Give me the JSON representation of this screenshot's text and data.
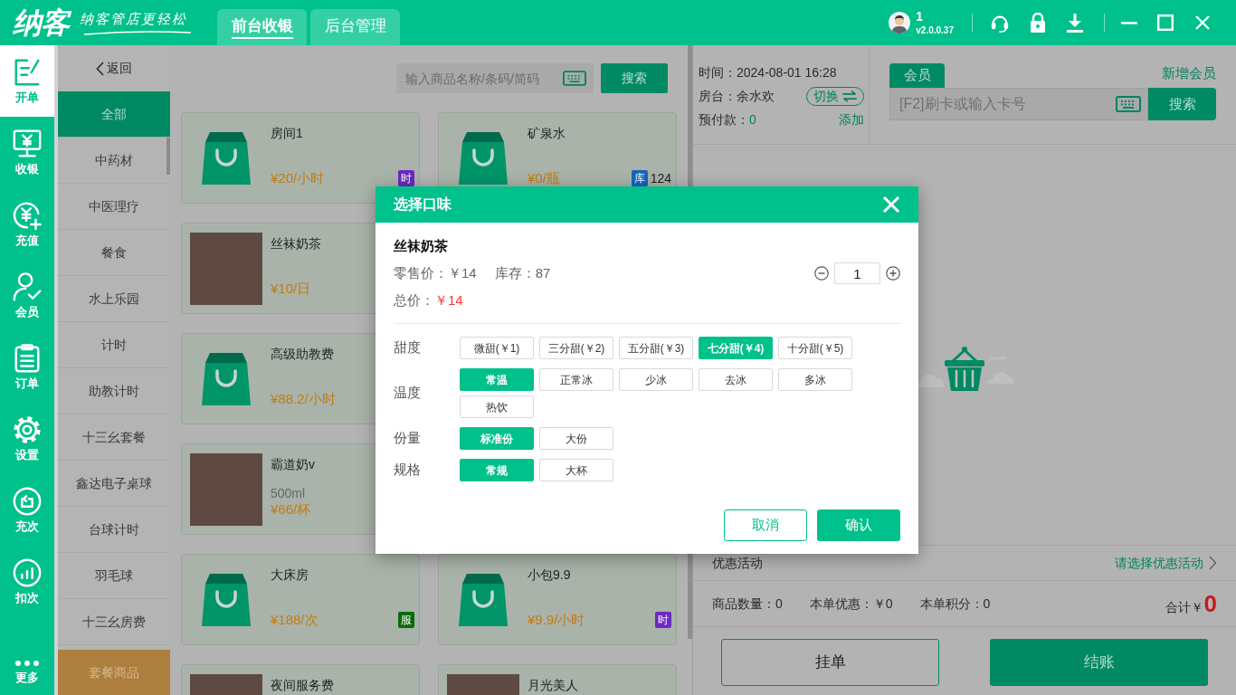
{
  "app_bar": {
    "logo": "纳客",
    "slogan": "纳客管店更轻松",
    "tabs": [
      {
        "label": "前台收银",
        "selected": true
      },
      {
        "label": "后台管理",
        "selected": false
      }
    ],
    "user": "1",
    "version": "v2.0.0.37"
  },
  "nav": [
    {
      "label": "开单",
      "selected": true
    },
    {
      "label": "收银",
      "selected": false
    },
    {
      "label": "充值",
      "selected": false
    },
    {
      "label": "会员",
      "selected": false
    },
    {
      "label": "订单",
      "selected": false
    },
    {
      "label": "设置",
      "selected": false
    },
    {
      "label": "充次",
      "selected": false
    },
    {
      "label": "扣次",
      "selected": false
    }
  ],
  "nav_more": "更多",
  "categories": {
    "back": "返回",
    "items": [
      {
        "label": "全部",
        "selected": true
      },
      {
        "label": "中药材",
        "selected": false
      },
      {
        "label": "中医理疗",
        "selected": false
      },
      {
        "label": "餐食",
        "selected": false
      },
      {
        "label": "水上乐园",
        "selected": false
      },
      {
        "label": "计时",
        "selected": false
      },
      {
        "label": "助教计时",
        "selected": false
      },
      {
        "label": "十三幺套餐",
        "selected": false
      },
      {
        "label": "鑫达电子桌球",
        "selected": false
      },
      {
        "label": "台球计时",
        "selected": false
      },
      {
        "label": "羽毛球",
        "selected": false
      },
      {
        "label": "十三幺房费",
        "selected": false
      }
    ],
    "package": "套餐商品"
  },
  "product_search": {
    "placeholder": "输入商品名称/条码/简码",
    "button": "搜索"
  },
  "product_rows": [
    [
      {
        "kind": "bag",
        "name": "房间1",
        "price": "¥20/小时",
        "badge": {
          "text": "时",
          "color": "#6a2bbd"
        }
      },
      {
        "kind": "bag",
        "name": "矿泉水",
        "price": "¥0/瓶",
        "badge": {
          "text": "库",
          "color": "#1565c0"
        },
        "stock": "124"
      }
    ],
    [
      {
        "kind": "photo",
        "name": "丝袜奶茶",
        "price": "¥10/日"
      }
    ],
    [
      {
        "kind": "bag",
        "name": "高级助教费",
        "price": "¥88.2/小时"
      }
    ],
    [
      {
        "kind": "photo",
        "name": "霸道奶v",
        "spec": "500ml",
        "price": "¥66/杯"
      }
    ],
    [
      {
        "kind": "bag",
        "name": "大床房",
        "price": "¥188/次",
        "badge": {
          "text": "服",
          "color": "#0b6b0b"
        }
      },
      {
        "kind": "bag",
        "name": "小包9.9",
        "price": "¥9.9/小时",
        "badge": {
          "text": "时",
          "color": "#6a2bbd"
        }
      }
    ],
    [
      {
        "kind": "photo",
        "name": "夜间服务费"
      },
      {
        "kind": "photo",
        "name": "月光美人"
      }
    ]
  ],
  "order": {
    "time": "时间：2024-08-01 16:28",
    "table": "房台：余水欢",
    "switch": "切换",
    "prepaid_label": "预付款：",
    "prepaid": "0",
    "add": "添加"
  },
  "member": {
    "tab": "会员",
    "add": "新增会员",
    "placeholder": "[F2]刷卡或输入卡号",
    "button": "搜索"
  },
  "discount": {
    "label": "优惠活动",
    "action": "请选择优惠活动"
  },
  "summary": {
    "items": [
      "商品数量：0",
      "本单优惠：￥0",
      "本单积分：0"
    ],
    "total_label": "合计￥",
    "total": "0"
  },
  "actions": [
    {
      "label": "挂单",
      "kind": "secondary"
    },
    {
      "label": "结账",
      "kind": "primary"
    }
  ],
  "dialog": {
    "title": "选择口味",
    "product": "丝袜奶茶",
    "retail_price": "零售价：￥14",
    "stock": "库存：87",
    "quantity": "1",
    "total_label": "总价：",
    "total": "￥14",
    "groups": [
      {
        "label": "甜度",
        "options": [
          {
            "label": "微甜(￥1)",
            "selected": false
          },
          {
            "label": "三分甜(￥2)",
            "selected": false
          },
          {
            "label": "五分甜(￥3)",
            "selected": false
          },
          {
            "label": "七分甜(￥4)",
            "selected": true
          },
          {
            "label": "十分甜(￥5)",
            "selected": false
          }
        ]
      },
      {
        "label": "温度",
        "options": [
          {
            "label": "常温",
            "selected": true
          },
          {
            "label": "正常冰",
            "selected": false
          },
          {
            "label": "少冰",
            "selected": false
          },
          {
            "label": "去冰",
            "selected": false
          },
          {
            "label": "多冰",
            "selected": false
          },
          {
            "label": "热饮",
            "selected": false
          }
        ]
      },
      {
        "label": "份量",
        "options": [
          {
            "label": "标准份",
            "selected": true
          },
          {
            "label": "大份",
            "selected": false
          }
        ]
      },
      {
        "label": "规格",
        "options": [
          {
            "label": "常规",
            "selected": true
          },
          {
            "label": "大杯",
            "selected": false
          }
        ]
      }
    ],
    "buttons": [
      {
        "label": "取消",
        "kind": "secondary"
      },
      {
        "label": "确认",
        "kind": "primary"
      }
    ]
  }
}
